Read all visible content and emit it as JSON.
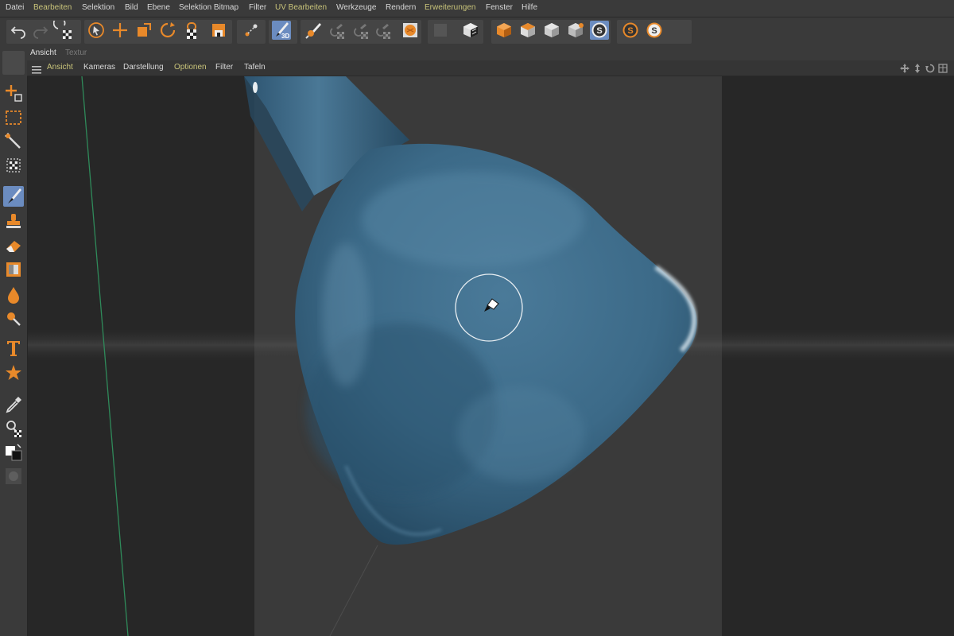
{
  "menubar": {
    "items": [
      {
        "label": "Datei",
        "highlight": false
      },
      {
        "label": "Bearbeiten",
        "highlight": true
      },
      {
        "label": "Selektion",
        "highlight": false
      },
      {
        "label": "Bild",
        "highlight": false
      },
      {
        "label": "Ebene",
        "highlight": false
      },
      {
        "label": "Selektion Bitmap",
        "highlight": false
      },
      {
        "label": "Filter",
        "highlight": false
      },
      {
        "label": "UV Bearbeiten",
        "highlight": true
      },
      {
        "label": "Werkzeuge",
        "highlight": false
      },
      {
        "label": "Rendern",
        "highlight": false
      },
      {
        "label": "Erweiterungen",
        "highlight": true
      },
      {
        "label": "Fenster",
        "highlight": false
      },
      {
        "label": "Hilfe",
        "highlight": false
      }
    ]
  },
  "tabs": [
    {
      "label": "Ansicht",
      "active": true
    },
    {
      "label": "Textur",
      "active": false
    }
  ],
  "viewmenu": {
    "items": [
      {
        "label": "Ansicht",
        "highlight": true
      },
      {
        "label": "Kameras",
        "highlight": false
      },
      {
        "label": "Darstellung",
        "highlight": false
      },
      {
        "label": "Optionen",
        "highlight": true
      },
      {
        "label": "Filter",
        "highlight": false
      },
      {
        "label": "Tafeln",
        "highlight": false
      }
    ]
  },
  "toolbar": {
    "icons": [
      "undo-icon",
      "redo-icon",
      "uv-checker-icon",
      "live-select-icon",
      "move-icon",
      "scale-icon",
      "rotate-icon",
      "lock-checker-icon",
      "texture-view-icon",
      "bodypaint-connect-icon",
      "paint-3d-icon",
      "paint-setup-wizard-icon",
      "project-paint-icon",
      "paint-layer-icon",
      "paint-mask-icon",
      "material-sphere-icon",
      "disabled-tool-icon",
      "checker-cube-icon",
      "cube-orange-icon",
      "cube-edge-icon",
      "cube-gray-icon",
      "cube-wire-icon",
      "s-gray-icon",
      "s-orange-icon",
      "s-white-icon"
    ]
  },
  "leftbar": {
    "icons": [
      "transform-icon",
      "rect-select-icon",
      "magic-wand-icon",
      "poly-select-icon",
      "brush-icon",
      "clone-stamp-icon",
      "eraser-icon",
      "gradient-icon",
      "fill-drop-icon",
      "smudge-icon",
      "text-icon",
      "star-shape-icon",
      "eyedropper-icon",
      "zoom-checker-icon",
      "color-swatch-icon",
      "disabled-circle-icon"
    ]
  },
  "colors": {
    "ui_bg": "#3a3a3a",
    "viewport_bg": "#262626",
    "menu_highlight": "#c9c47a",
    "accent_orange": "#e8892a",
    "active_blue": "#6b8cc0",
    "model_blue": "#3f6b8a"
  }
}
